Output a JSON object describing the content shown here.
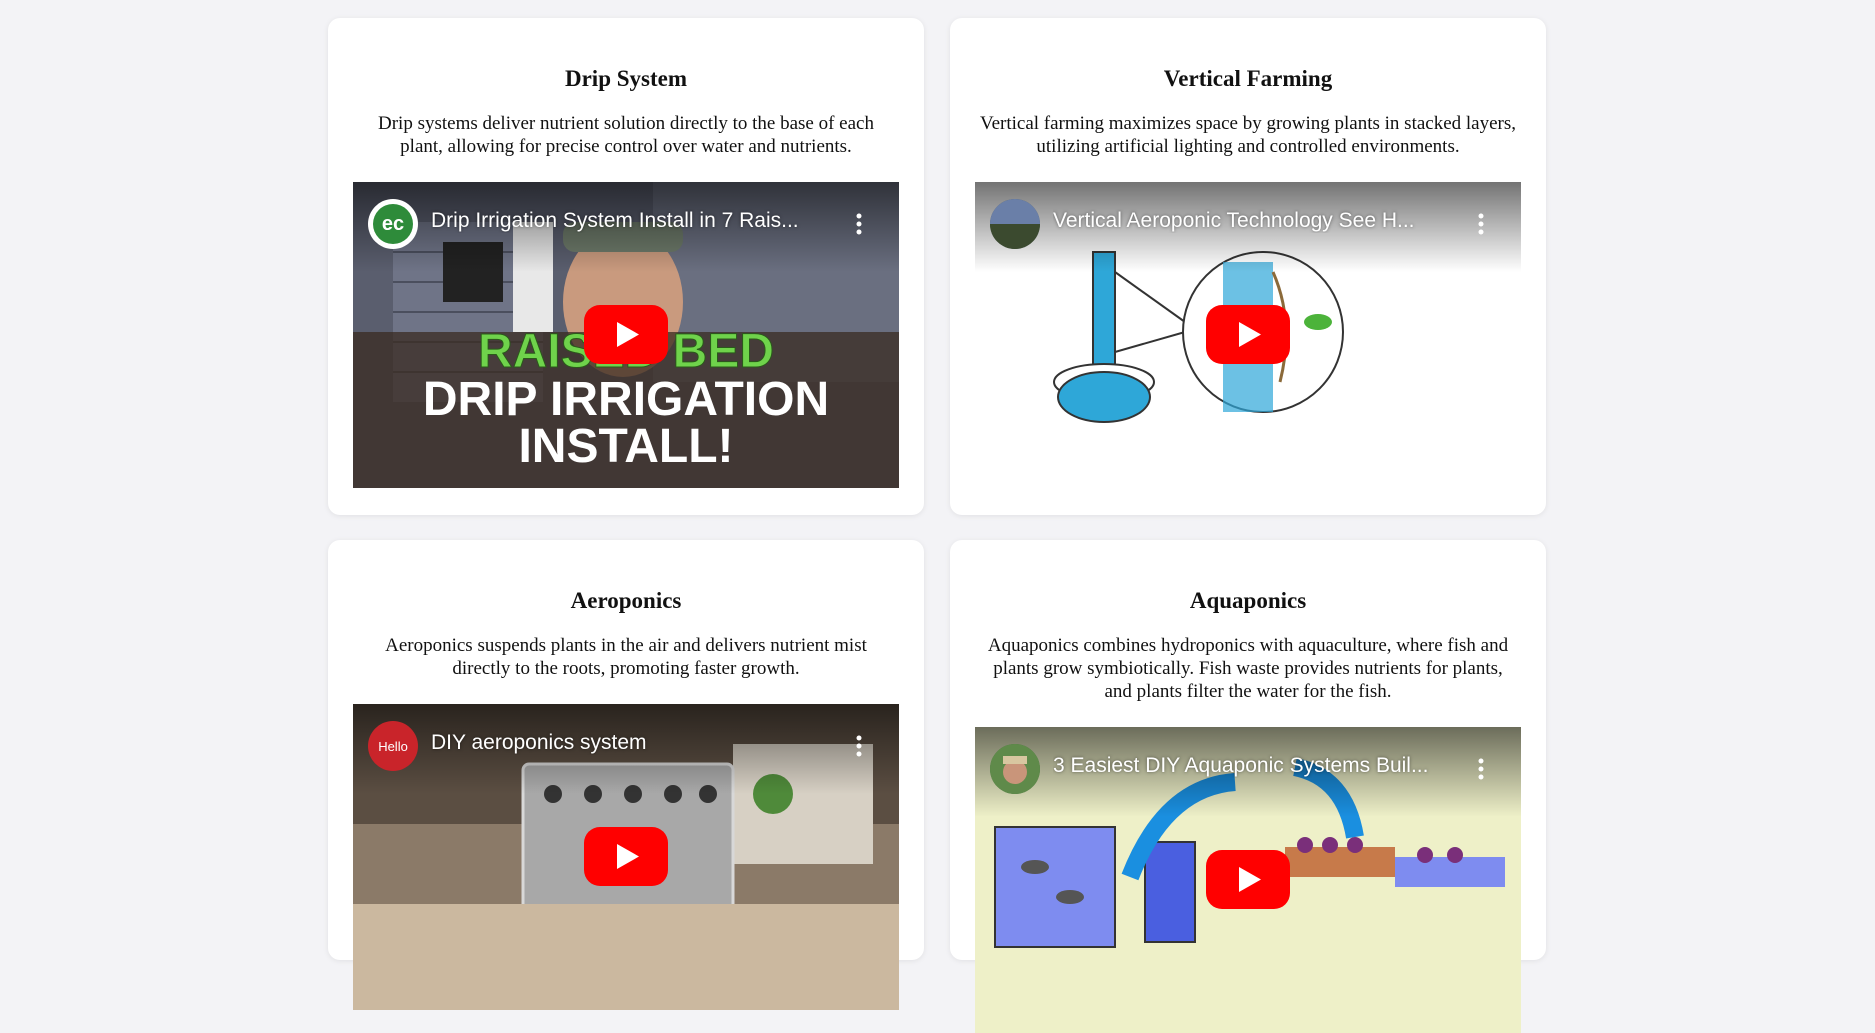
{
  "cards": [
    {
      "title": "Drip System",
      "description": "Drip systems deliver nutrient solution directly to the base of each plant, allowing for precise control over water and nutrients.",
      "video": {
        "title": "Drip Irrigation System Install in 7 Rais...",
        "thumbnail_line1": "RAISED BED",
        "thumbnail_line2": "DRIP IRRIGATION",
        "thumbnail_line3": "INSTALL!",
        "channel_avatar_text": "ec"
      }
    },
    {
      "title": "Vertical Farming",
      "description": "Vertical farming maximizes space by growing plants in stacked layers, utilizing artificial lighting and controlled environments.",
      "video": {
        "title": "Vertical Aeroponic Technology See H..."
      }
    },
    {
      "title": "Aeroponics",
      "description": "Aeroponics suspends plants in the air and delivers nutrient mist directly to the roots, promoting faster growth.",
      "video": {
        "title": "DIY aeroponics system",
        "channel_avatar_text": "Hello"
      }
    },
    {
      "title": "Aquaponics",
      "description": "Aquaponics combines hydroponics with aquaculture, where fish and plants grow symbiotically. Fish waste provides nutrients for plants, and plants filter the water for the fish.",
      "video": {
        "title": "3 Easiest DIY Aquaponic Systems Buil..."
      }
    }
  ],
  "colors": {
    "page_bg": "#f3f3f6",
    "card_bg": "#ffffff",
    "play_red": "#ff0000",
    "drip_green": "#6fd34b"
  }
}
